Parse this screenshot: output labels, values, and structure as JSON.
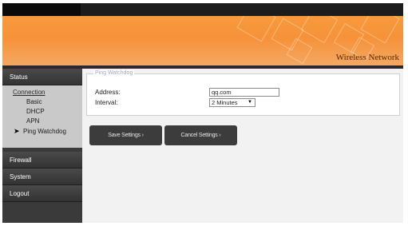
{
  "header": {
    "brand": "Wireless Network"
  },
  "sidebar": {
    "status_label": "Status",
    "connection_label": "Connection",
    "items": [
      {
        "label": "Basic"
      },
      {
        "label": "DHCP"
      },
      {
        "label": "APN"
      },
      {
        "label": "Ping Watchdog",
        "active": true
      }
    ],
    "firewall_label": "Firewall",
    "system_label": "System",
    "logout_label": "Logout"
  },
  "form": {
    "section_title": "Ping Watchdog",
    "address_label": "Address:",
    "address_value": "qq.com",
    "interval_label": "Interval:",
    "interval_value": "2 Minutes"
  },
  "buttons": {
    "save_label": "Save Settings",
    "cancel_label": "Cancel Settings"
  },
  "colors": {
    "accent": "#f79a3c",
    "sidebar": "#3a3a3a",
    "button": "#3c3c3c"
  }
}
